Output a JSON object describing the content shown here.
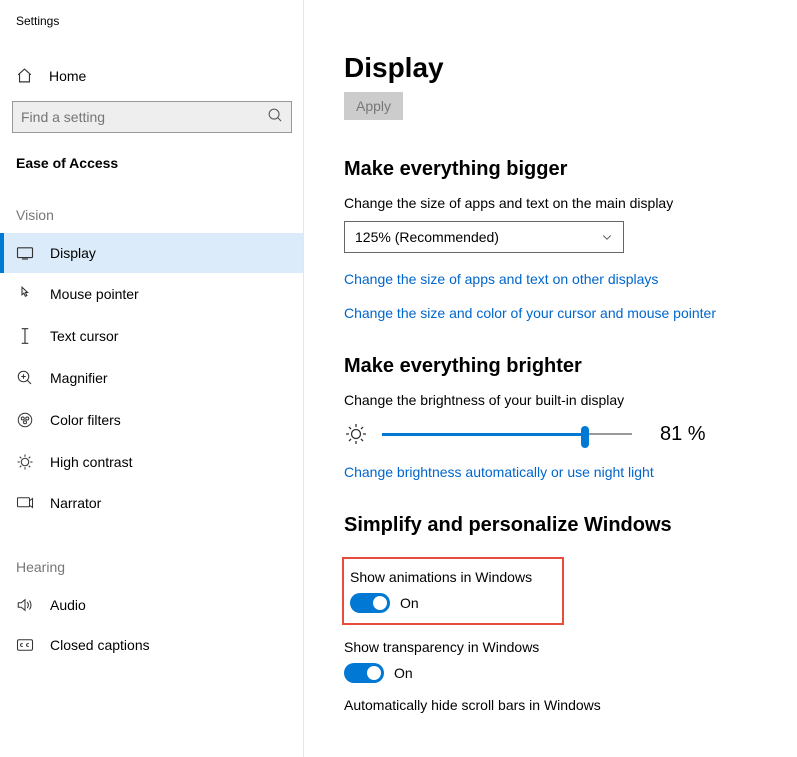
{
  "app_title": "Settings",
  "home_label": "Home",
  "search_placeholder": "Find a setting",
  "category_label": "Ease of Access",
  "groups": {
    "vision": "Vision",
    "hearing": "Hearing"
  },
  "nav": {
    "display": "Display",
    "mouse_pointer": "Mouse pointer",
    "text_cursor": "Text cursor",
    "magnifier": "Magnifier",
    "color_filters": "Color filters",
    "high_contrast": "High contrast",
    "narrator": "Narrator",
    "audio": "Audio",
    "closed_captions": "Closed captions"
  },
  "main": {
    "title": "Display",
    "apply": "Apply",
    "bigger": {
      "heading": "Make everything bigger",
      "desc": "Change the size of apps and text on the main display",
      "dropdown_value": "125% (Recommended)",
      "link1": "Change the size of apps and text on other displays",
      "link2": "Change the size and color of your cursor and mouse pointer"
    },
    "brighter": {
      "heading": "Make everything brighter",
      "desc": "Change the brightness of your built-in display",
      "percent": "81 %",
      "link": "Change brightness automatically or use night light"
    },
    "simplify": {
      "heading": "Simplify and personalize Windows",
      "anim_label": "Show animations in Windows",
      "anim_state": "On",
      "trans_label": "Show transparency in Windows",
      "trans_state": "On",
      "scroll_label": "Automatically hide scroll bars in Windows"
    }
  }
}
